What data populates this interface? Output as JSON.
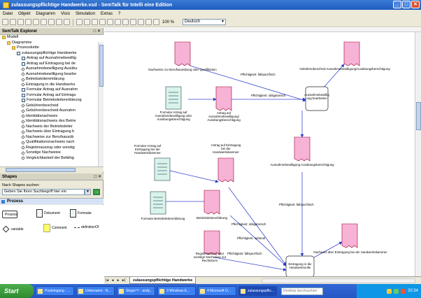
{
  "window": {
    "title": "zulassungspflichtige Handwerke.vsd - SemTalk für Intelli eine Edition"
  },
  "menu": [
    "Datei",
    "Objekt",
    "Diagramm",
    "Visio",
    "Simulation",
    "Extras",
    "?"
  ],
  "toolbar": {
    "zoom": "100 %",
    "language": "Deutsch"
  },
  "explorer": {
    "title": "SemTalk Explorer",
    "tree": [
      {
        "label": "Modell",
        "level": 0,
        "icon": "folder"
      },
      {
        "label": "Diagramme",
        "level": 1,
        "icon": "folder"
      },
      {
        "label": "Prozesskette",
        "level": 2,
        "icon": "folder"
      },
      {
        "label": "zulassungspflichtige Handwerke",
        "level": 3,
        "icon": "doc"
      },
      {
        "label": "Antrag auf Ausnahmebewillig",
        "level": 4,
        "icon": "doc"
      },
      {
        "label": "Antrag auf Eintragung bei de",
        "level": 4,
        "icon": "doc"
      },
      {
        "label": "Ausnahmebewilligung Ausübu",
        "level": 4,
        "icon": "diamond"
      },
      {
        "label": "Ausnahmebewilligung bearbe",
        "level": 4,
        "icon": "diamond"
      },
      {
        "label": "Betriebsleitererklärung",
        "level": 4,
        "icon": "diamond"
      },
      {
        "label": "Eintragung in die Handwerks",
        "level": 4,
        "icon": "diamond"
      },
      {
        "label": "Formular Antrag auf Ausnahm",
        "level": 4,
        "icon": "doc"
      },
      {
        "label": "Formular Antrag auf Eintragu",
        "level": 4,
        "icon": "doc"
      },
      {
        "label": "Formular Betriebsleitererklärung",
        "level": 4,
        "icon": "doc"
      },
      {
        "label": "Gebührenbescheid",
        "level": 4,
        "icon": "diamond"
      },
      {
        "label": "Gebührenbescheid Ausnahm",
        "level": 4,
        "icon": "diamond"
      },
      {
        "label": "Identitätsnachweis",
        "level": 4,
        "icon": "diamond"
      },
      {
        "label": "Identitätsnachweis des Betrie",
        "level": 4,
        "icon": "diamond"
      },
      {
        "label": "Nachweis der Betriebsleiter",
        "level": 4,
        "icon": "diamond"
      },
      {
        "label": "Nachweis über Eintragung b",
        "level": 4,
        "icon": "diamond"
      },
      {
        "label": "Nachweise zur Berufsausüb",
        "level": 4,
        "icon": "diamond"
      },
      {
        "label": "Qualifikationsnachweis nach",
        "level": 4,
        "icon": "diamond"
      },
      {
        "label": "Registerauszug oder sonstig",
        "level": 4,
        "icon": "diamond"
      },
      {
        "label": "Sonstige Nachweise",
        "level": 4,
        "icon": "diamond"
      },
      {
        "label": "Vergleichbarkeit der Befähig",
        "level": 4,
        "icon": "diamond"
      }
    ]
  },
  "shapes": {
    "title": "Shapes",
    "search_label": "Nach Shapes suchen:",
    "search_value": "Geben Sie Ihren Suchbegriff hier ein",
    "category": "Prozess",
    "items": {
      "prozess": "Prozess",
      "dokument": "Dokument",
      "formular": "Formular",
      "variable": "variable",
      "comment": "Comment",
      "definition": "definitionOf"
    }
  },
  "diagram": {
    "nodes": {
      "nachweise_beruf": "Nachweise zur Berufsausübung oder Qualifikation",
      "formular_ausnahme": "Formular Antrag auf Ausnahmebewilligung oder Ausübungsberechtigung",
      "antrag_ausnahme": "Antrag auf Ausnahmebewilligung/ Ausübungsberechtigung",
      "gebuehrenbescheid": "Gebührenbescheid Ausnahmebewilligung/Ausübungsberechtigung",
      "ausnahme_bearbeiten": "Ausnahmebewillig ung bearbeiten",
      "ausnahme_result": "Ausnahmebewilligung Ausübungsberechtigung",
      "formular_eintragung": "Formular Antrag auf Eintragung bei der Handwerkskammer",
      "antrag_eintragung": "Antrag auf Eintragung bei der Handwerkskammer",
      "formular_betrieb": "Formular Betriebsleitererklärung",
      "betriebsleiter": "Betriebsleitererklärung",
      "registerauszug": "Registerauszug oder sonstige Nachweise zur Rechtsform",
      "nachweis_eintragung": "Nachweis über Eintragung bei der Handwerkskammer",
      "eintragung": "Eintragung in die Handwerksrolle"
    },
    "edges": {
      "optional_1": "Pflichtigkeit: fallspezifisch",
      "obligatory_1": "Pflichtigkeit: obligatorisch",
      "fall_2": "Pflichtigkeit: fallspezifisch",
      "obligatory_2": "Pflichtigkeit: obligatorisch",
      "optional_2": "Pflichtigkeit: optional",
      "fall_3": "Pflichtigkeit: fallspezifisch"
    }
  },
  "sheet": {
    "tab": "zulassungspflichtige Handwerke"
  },
  "taskbar": {
    "start": "Start",
    "tasks": [
      "Posteingang - ...",
      "Unbenannt - N...",
      "Skype™ - andy...",
      "3 Windows E...",
      "4 Microsoft O...",
      "zulassungspflic..."
    ],
    "search": "Desktop durchsuchen",
    "clock": "20:34"
  }
}
